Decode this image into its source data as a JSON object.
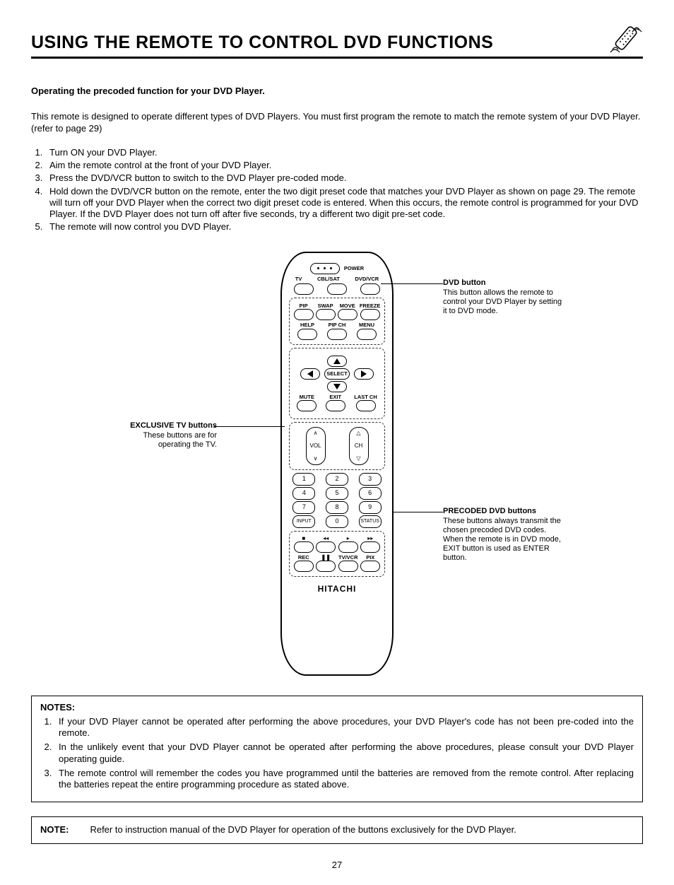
{
  "header": {
    "title": "USING THE REMOTE TO CONTROL DVD FUNCTIONS"
  },
  "subhead": "Operating the precoded function for your DVD Player.",
  "intro": "This remote is designed to operate different types of DVD Players. You must first program the remote to match the remote system of your DVD Player. (refer to page 29)",
  "steps": [
    "Turn ON your DVD Player.",
    "Aim the remote control at the front of your DVD Player.",
    "Press the DVD/VCR button to switch to the DVD Player pre-coded mode.",
    "Hold down the DVD/VCR button on the remote, enter the two digit preset code that matches your DVD Player as shown on page 29. The remote will turn off your DVD Player when the correct two digit preset code is entered. When this occurs, the remote control is programmed for your DVD Player. If the DVD Player does not turn off after five seconds, try a different two digit pre-set code.",
    "The remote will now control you DVD Player."
  ],
  "remote": {
    "power": "POWER",
    "tv": "TV",
    "cblsat": "CBL/SAT",
    "dvdvcr": "DVD/VCR",
    "pip": "PIP",
    "swap": "SWAP",
    "move": "MOVE",
    "freeze": "FREEZE",
    "help": "HELP",
    "pipch": "PIP CH",
    "menu": "MENU",
    "select": "SELECT",
    "mute": "MUTE",
    "exit": "EXIT",
    "lastch": "LAST CH",
    "vol": "VOL",
    "ch": "CH",
    "n1": "1",
    "n2": "2",
    "n3": "3",
    "n4": "4",
    "n5": "5",
    "n6": "6",
    "n7": "7",
    "n8": "8",
    "n9": "9",
    "n0": "0",
    "input": "INPUT",
    "status": "STATUS",
    "rec": "REC",
    "tvvcr": "TV/VCR",
    "pix": "PIX",
    "brand": "HITACHI"
  },
  "callouts": {
    "dvd": {
      "title": "DVD button",
      "desc": "This button allows the remote to control your DVD Player by setting it to DVD mode."
    },
    "exclusive": {
      "title": "EXCLUSIVE TV buttons",
      "desc": "These buttons are for operating the TV."
    },
    "precoded": {
      "title": "PRECODED DVD buttons",
      "desc": "These buttons always transmit the chosen precoded DVD codes. When the remote is in DVD mode, EXIT button is used as ENTER button."
    }
  },
  "notes": {
    "heading": "NOTES:",
    "items": [
      "If your DVD Player cannot be operated after performing the above procedures, your DVD Player's code has not been pre-coded into the remote.",
      "In the unlikely event that your DVD Player cannot be operated after performing the above procedures, please consult your DVD Player operating guide.",
      "The remote control will remember the codes you have programmed until the batteries are removed from the remote control. After replacing the batteries repeat the entire programming procedure as stated above."
    ]
  },
  "note2": {
    "label": "NOTE:",
    "text": "Refer to instruction manual of the DVD Player for operation of the buttons exclusively for the DVD Player."
  },
  "pagenum": "27"
}
